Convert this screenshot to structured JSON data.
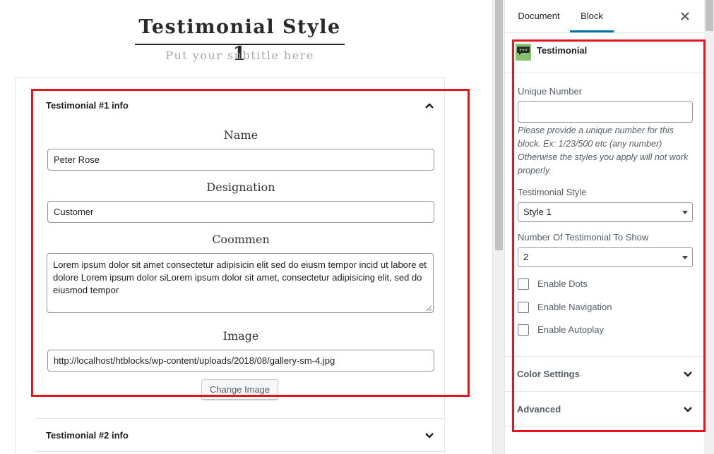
{
  "canvas": {
    "title": "Testimonial Style 1",
    "subtitle": "Put your subtitle here",
    "panel1": {
      "heading": "Testimonial #1 info",
      "name_label": "Name",
      "name_value": "Peter Rose",
      "designation_label": "Designation",
      "designation_value": "Customer",
      "comment_label": "Coommen",
      "comment_value": "Lorem ipsum dolor sit amet consectetur adipisicin elit sed do eiusm tempor incid ut labore et dolore Lorem ipsum dolor siLorem ipsum dolor sit amet, consectetur adipisicing elit, sed do eiusmod tempor",
      "image_label": "Image",
      "image_value": "http://localhost/htblocks/wp-content/uploads/2018/08/gallery-sm-4.jpg",
      "change_image_button": "Change Image"
    },
    "panel2": {
      "heading": "Testimonial #2 info"
    }
  },
  "sidebar": {
    "tabs": [
      "Document",
      "Block"
    ],
    "active_tab": "Block",
    "block_name": "Testimonial",
    "unique_number_label": "Unique Number",
    "unique_number_value": "",
    "unique_number_help": "Please provide a unique number for this block. Ex: 1/23/500 etc (any number) Otherwise the styles you apply will not work properly.",
    "style_label": "Testimonial Style",
    "style_value": "Style 1",
    "count_label": "Number Of Testimonial To Show",
    "count_value": "2",
    "checkboxes": [
      {
        "label": "Enable Dots",
        "checked": false
      },
      {
        "label": "Enable Navigation",
        "checked": false
      },
      {
        "label": "Enable Autoplay",
        "checked": false
      }
    ],
    "panels": [
      "Color Settings",
      "Advanced"
    ]
  },
  "colors": {
    "highlight": "#e6151d",
    "accent": "#0073aa",
    "icon_bg": "#84c36b"
  }
}
